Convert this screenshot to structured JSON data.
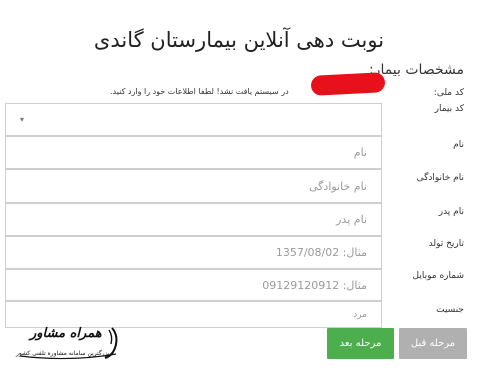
{
  "page": {
    "title": "نوبت دهی آنلاین بیمارستان گاندی",
    "section_title": "مشخصات بیمار:"
  },
  "notice": {
    "national_id_label": "کد ملی:",
    "message": "در سیستم یافت نشد! لطفا اطلاعات خود را وارد کنید."
  },
  "form": {
    "patient_code": {
      "label": "کد بیمار",
      "value": ""
    },
    "first_name": {
      "label": "نام",
      "placeholder": "نام"
    },
    "last_name": {
      "label": "نام خانوادگی",
      "placeholder": "نام خانوادگی"
    },
    "father_name": {
      "label": "نام پدر",
      "placeholder": "نام پدر"
    },
    "birth_date": {
      "label": "تاریخ تولد",
      "placeholder": "مثال: 1357/08/02"
    },
    "mobile": {
      "label": "شماره موبایل",
      "placeholder": "مثال: 09129120912"
    },
    "gender": {
      "label": "جنسیت",
      "value": "مرد"
    }
  },
  "buttons": {
    "next": "مرحله بعد",
    "prev": "مرحله قبل"
  },
  "watermark": {
    "brand": "همراه مشاور",
    "tagline": "بزرگترین سامانه مشاوره تلفنی کشور"
  },
  "colors": {
    "next_button": "#4cae4c",
    "prev_button": "#b0b0b0",
    "redaction": "#e8101b"
  },
  "icons": {
    "select_caret": "chevron-down-icon"
  }
}
